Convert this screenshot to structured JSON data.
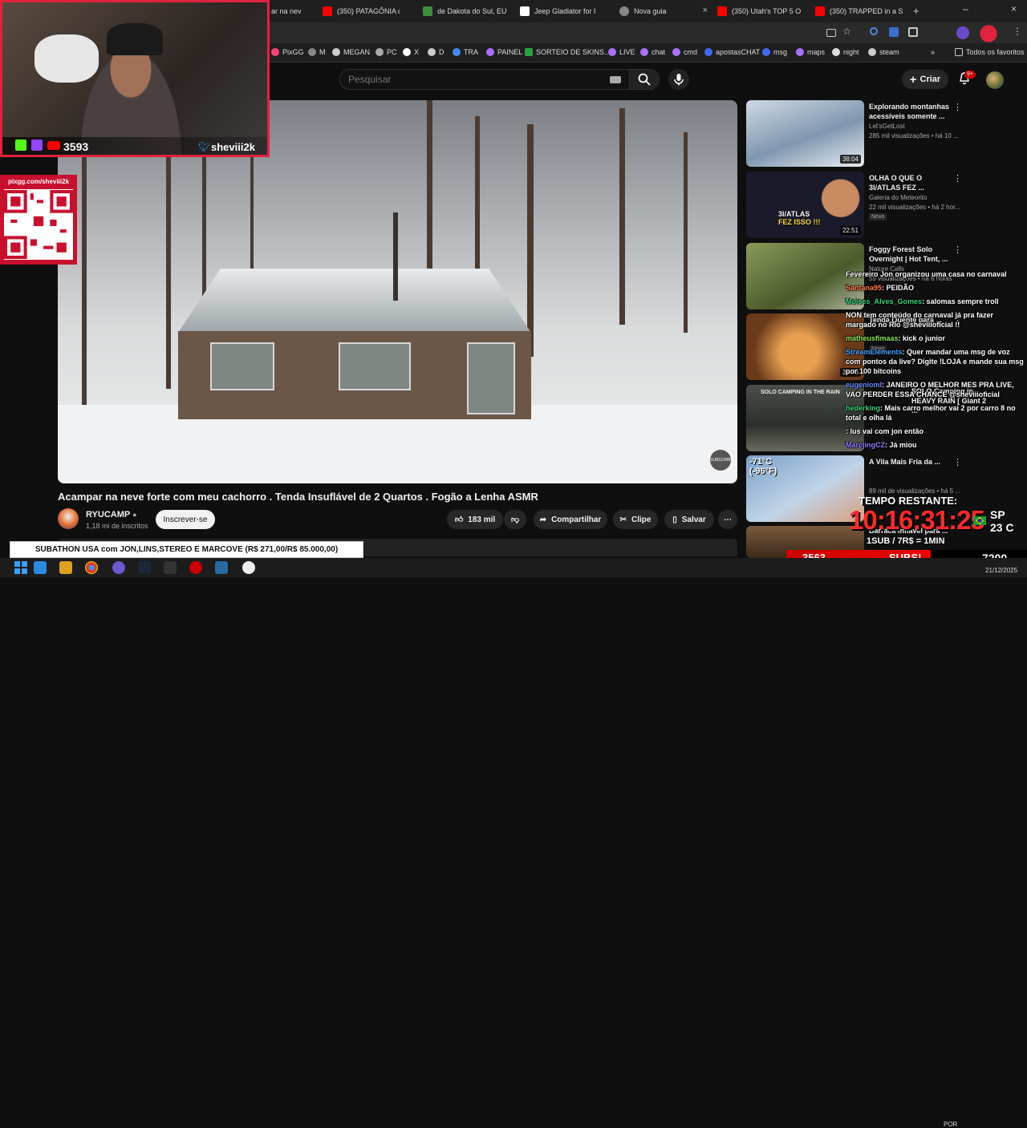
{
  "tabs": [
    {
      "label": "ar na nev",
      "color": "#555"
    },
    {
      "label": "(350) PATAGÔNIA de",
      "color": "#ff0000"
    },
    {
      "label": "de Dakota do Sul, EU",
      "color": "#3c8d3c"
    },
    {
      "label": "Jeep Gladiator for Re",
      "color": "#ffffff"
    },
    {
      "label": "Nova guia",
      "color": "#888888"
    },
    {
      "label": "(350) Utah's TOP 5 O",
      "color": "#ff0000"
    },
    {
      "label": "(350) TRAPPED in a S",
      "color": "#ff0000"
    }
  ],
  "bookmarks": [
    {
      "label": "PixGG",
      "color": "#ff4477"
    },
    {
      "label": "M",
      "color": "#888"
    },
    {
      "label": "MEGAN",
      "color": "#ccc"
    },
    {
      "label": "PC",
      "color": "#aaa"
    },
    {
      "label": "X",
      "color": "#fff"
    },
    {
      "label": "D",
      "color": "#ccc"
    },
    {
      "label": "TRA",
      "color": "#4488ff"
    },
    {
      "label": "PAINEL",
      "color": "#a970ff"
    },
    {
      "label": "SORTEIO DE SKINS...",
      "color": "#2ea043"
    },
    {
      "label": "LIVE",
      "color": "#a970ff"
    },
    {
      "label": "chat",
      "color": "#a970ff"
    },
    {
      "label": "cmd",
      "color": "#a970ff"
    },
    {
      "label": "apostasCHAT",
      "color": "#4466ff"
    },
    {
      "label": "msg",
      "color": "#4466ff"
    },
    {
      "label": "maps",
      "color": "#a970ff"
    },
    {
      "label": "night",
      "color": "#ddd"
    },
    {
      "label": "steam",
      "color": "#ccc"
    }
  ],
  "bookmarks_all": "Todos os favoritos",
  "search": {
    "placeholder": "Pesquisar"
  },
  "header": {
    "create_label": "Criar",
    "notif_badge": "9+"
  },
  "video": {
    "title": "Acampar na neve forte com meu cachorro . Tenda Insuflável de 2 Quartos . Fogão a Lenha ASMR",
    "channel": "RYUCAMP",
    "subscribers": "1,18 mi de inscritos",
    "subscribe_label": "Inscrever-se",
    "likes": "183 mil",
    "share_label": "Compartilhar",
    "clip_label": "Clipe",
    "save_label": "Salvar",
    "watermark": "SUBSCRIBE"
  },
  "recommendations": [
    {
      "title": "Explorando montanhas acessíveis somente ...",
      "channel": "Let'sGetLost",
      "views": "285 mil visualizações • há 10 ...",
      "duration": "38:04",
      "badge": "",
      "thumb": "#9fb4c8"
    },
    {
      "title": "OLHA O QUE O 3I/ATLAS FEZ ...",
      "channel": "Galeria do Meteorito",
      "views": "22 mil visualizações • há 2 hor...",
      "duration": "22:51",
      "badge": "Novo",
      "thumb": "#1a1a2a"
    },
    {
      "title": "Foggy Forest Solo Overnight | Hot Tent, ...",
      "channel": "Nature Calls",
      "views": "55 visualizações • há 6 horas",
      "duration": "",
      "badge": "",
      "thumb": "#6f7a4a"
    },
    {
      "title": "Tenda Quente para ...",
      "channel": "",
      "views": "",
      "duration": "33:46",
      "badge": "Novo",
      "thumb": "#8a5a2a"
    },
    {
      "title": "SOLO Camping in HEAVY RAIN [ Giant 2 ...",
      "channel": "",
      "views": "",
      "duration": "",
      "badge": "",
      "thumb": "#555d52"
    },
    {
      "title": "A Vila Mais Fria da ...",
      "channel": "",
      "views": "89 mil de visualizações • há 5 ...",
      "duration": "",
      "badge": "",
      "thumb": "#7aa0c8"
    },
    {
      "title": "Barraca inflável para ...",
      "channel": "",
      "views": "",
      "duration": "",
      "badge": "",
      "thumb": "#6a4a2a"
    }
  ],
  "overlay": {
    "viewers": "3593",
    "handle": "sheviii2k",
    "qr_label": "pixgg.com/sheviii2k",
    "chat": [
      {
        "user": "",
        "text": "Fevereiro Jon organizou uma casa no carnaval"
      },
      {
        "user": "Santana95",
        "text": ": PEIDÃO"
      },
      {
        "user": "Moises_Alves_Gomes",
        "text": ": salomas sempre troll"
      },
      {
        "user": "",
        "text": "NON tem conteúdo do carnaval já pra fazer margado no Rio @sheviiioficial !!"
      },
      {
        "user": "matheusfimaas",
        "text": ": kick o junior"
      },
      {
        "user": "StreamElements",
        "text": ": Quer mandar uma msg de voz com pontos da live? Digite !LOJA e mande sua msg por 100 bitcoins"
      },
      {
        "user": "eugenioml",
        "text": ": JANEIRO O MELHOR MES PRA LIVE, VAO PERDER ESSA CHANCE @sheviiioficial"
      },
      {
        "user": "hederking",
        "text": ": Mais carro melhor vai 2 por carro 8 no total e olha lá"
      },
      {
        "user": "",
        "text": ": lus vai com jon então"
      },
      {
        "user": "MarcjingCZ",
        "text": ": Já miou"
      }
    ],
    "timer_label": "TEMPO RESTANTE:",
    "timer": "10:16:31:25",
    "location": "SP",
    "temperature": "23 C",
    "rate": "1SUB / 7R$ = 1MIN",
    "subathon": "SUBATHON USA com JON,LINS,STEREO E MARCOVE (R$ 271,00/R$ 85.000,00)",
    "subs_count": "3563",
    "subs_word": "SUBS!",
    "subs_goal": "7200"
  },
  "taskbar": {
    "lang": "POR",
    "date": "21/12/2025"
  }
}
